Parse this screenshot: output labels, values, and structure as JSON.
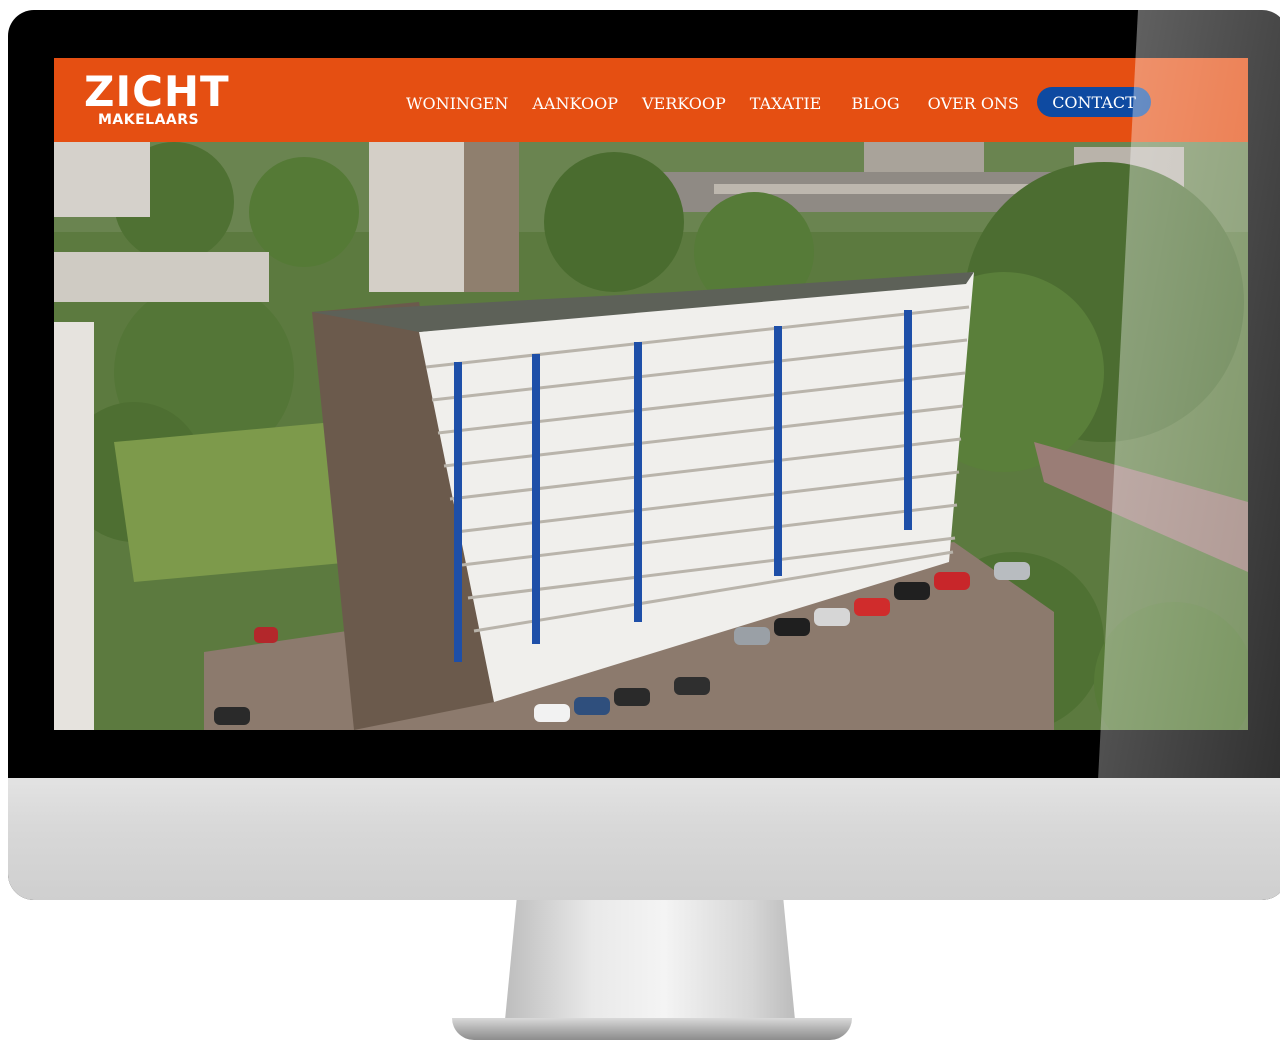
{
  "brand": {
    "name": "ZICHT",
    "tagline": "MAKELAARS",
    "header_color": "#e54f12",
    "button_color": "#0e4aa1"
  },
  "nav": {
    "items": [
      {
        "label": "WONINGEN"
      },
      {
        "label": "AANKOOP"
      },
      {
        "label": "VERKOOP"
      },
      {
        "label": "TAXATIE"
      },
      {
        "label": "BLOG"
      },
      {
        "label": "OVER ONS"
      }
    ],
    "contact_label": "CONTACT"
  },
  "hero": {
    "image_subject": "aerial-apartment-building-photo"
  }
}
